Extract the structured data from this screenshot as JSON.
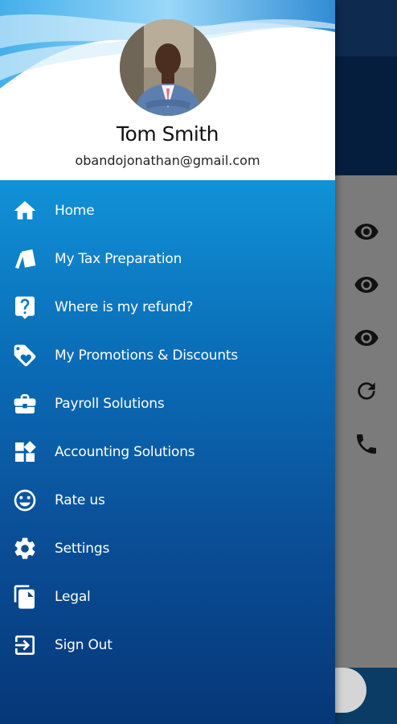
{
  "user": {
    "name": "Tom Smith",
    "email": "obandojonathan@gmail.com"
  },
  "menu": {
    "items": [
      {
        "label": "Home",
        "icon": "home-icon"
      },
      {
        "label": "My Tax Preparation",
        "icon": "tax-cards-icon"
      },
      {
        "label": "Where is my refund?",
        "icon": "help-icon"
      },
      {
        "label": "My Promotions & Discounts",
        "icon": "tag-heart-icon"
      },
      {
        "label": "Payroll Solutions",
        "icon": "briefcase-icon"
      },
      {
        "label": "Accounting Solutions",
        "icon": "widgets-icon"
      },
      {
        "label": "Rate us",
        "icon": "smiley-icon"
      },
      {
        "label": "Settings",
        "icon": "gear-icon"
      },
      {
        "label": "Legal",
        "icon": "documents-icon"
      },
      {
        "label": "Sign Out",
        "icon": "sign-out-icon"
      }
    ]
  },
  "background_icons": [
    "eye-icon",
    "eye-icon",
    "eye-icon",
    "refresh-icon",
    "phone-icon"
  ],
  "colors": {
    "menu_gradient_top": "#1192d8",
    "menu_gradient_bottom": "#063778",
    "header_dark": "#061e3e"
  }
}
